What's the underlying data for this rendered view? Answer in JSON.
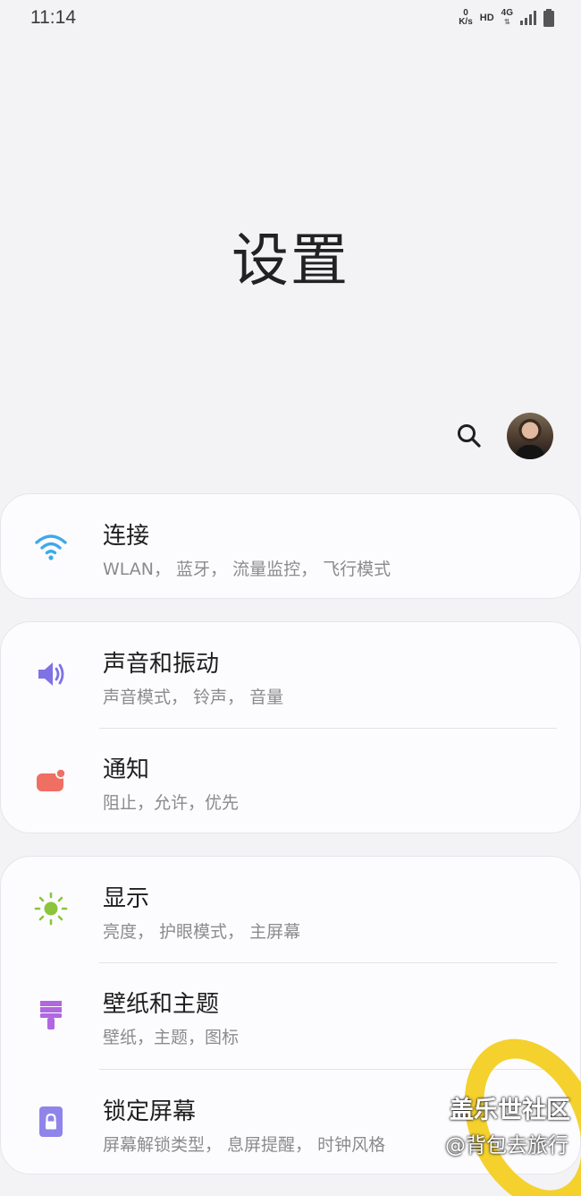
{
  "status_bar": {
    "time": "11:14",
    "net_speed_value": "0",
    "net_speed_unit": "K/s",
    "hd": "HD",
    "network": "4G"
  },
  "title": "设置",
  "header": {
    "search_icon": "search-icon",
    "avatar": "profile-photo"
  },
  "groups": [
    {
      "items": [
        {
          "title": "连接",
          "subtitle": "WLAN， 蓝牙， 流量监控， 飞行模式",
          "icon": "wifi-icon",
          "icon_color": "#3fa9e8"
        }
      ]
    },
    {
      "items": [
        {
          "title": "声音和振动",
          "subtitle": "声音模式， 铃声， 音量",
          "icon": "speaker-icon",
          "icon_color": "#7e72e4"
        },
        {
          "title": "通知",
          "subtitle": "阻止，允许，优先",
          "icon": "notification-icon",
          "icon_color": "#ef6f63"
        }
      ]
    },
    {
      "items": [
        {
          "title": "显示",
          "subtitle": "亮度， 护眼模式， 主屏幕",
          "icon": "brightness-icon",
          "icon_color": "#8cc43b"
        },
        {
          "title": "壁纸和主题",
          "subtitle": "壁纸，主题，图标",
          "icon": "paintbrush-icon",
          "icon_color": "#b067e0"
        },
        {
          "title": "锁定屏幕",
          "subtitle": "屏幕解锁类型， 息屏提醒， 时钟风格",
          "icon": "lock-icon",
          "icon_color": "#8f84ea"
        }
      ]
    }
  ],
  "watermark": {
    "line1": "盖乐世社区",
    "line2": "@背包去旅行",
    "accent": "#f3cf22"
  }
}
